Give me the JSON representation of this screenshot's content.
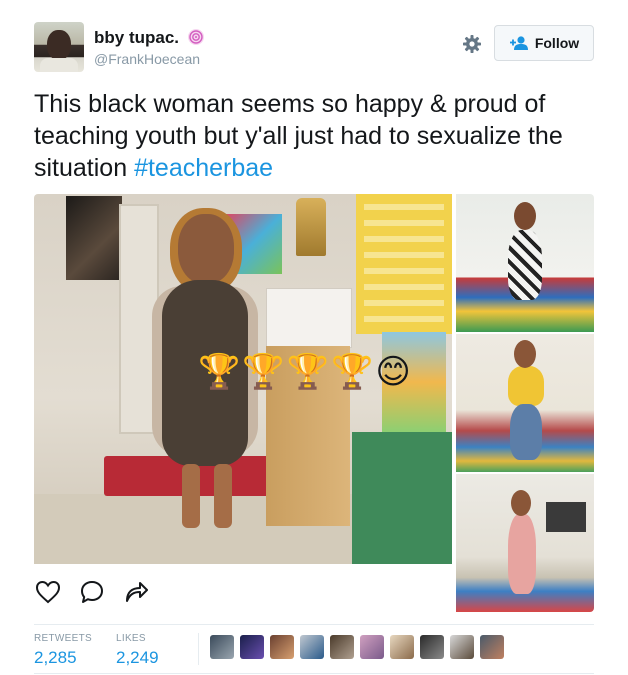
{
  "user": {
    "display_name": "bby tupac.",
    "handle": "@FrankHoecean",
    "badge_icon": "swirl-lollipop-icon",
    "avatar_icon": "avatar-photo"
  },
  "header": {
    "follow_label": "Follow",
    "follow_icon": "add-person-icon",
    "gear_icon": "gear-icon"
  },
  "tweet": {
    "text_before": "This black woman seems so happy & proud of teaching youth but y'all just had to sexualize the situation ",
    "hashtag": "#teacherbae",
    "hashtag_color": "#1b95e0",
    "photo_overlay_emojis": "🏆🏆🏆🏆😊"
  },
  "media": {
    "photo_count": 4
  },
  "actions": {
    "reply_icon": "heart-outline-icon",
    "comment_icon": "speech-bubble-icon",
    "share_icon": "share-arrow-icon"
  },
  "stats": {
    "retweets_label": "RETWEETS",
    "retweets_value": "2,285",
    "likes_label": "LIKES",
    "likes_value": "2,249",
    "liker_avatar_count": 10
  }
}
